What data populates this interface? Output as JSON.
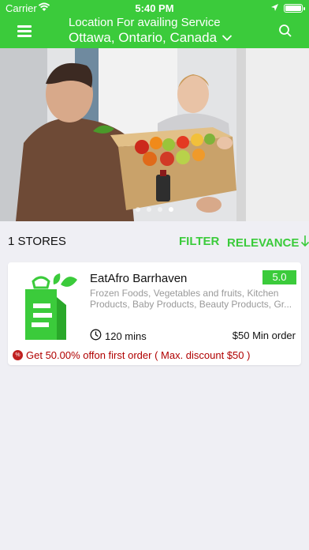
{
  "status_bar": {
    "carrier": "Carrier",
    "time": "5:40 PM"
  },
  "header": {
    "location_label": "Location For availing Service",
    "location_value": "Ottawa, Ontario, Canada"
  },
  "banner": {
    "slide_count": 4,
    "active_index": 3
  },
  "toolbar": {
    "store_count": "1 STORES",
    "filter_label": "FILTER",
    "sort_label": "RELEVANCE"
  },
  "stores": [
    {
      "name": "EatAfro Barrhaven",
      "rating": "5.0",
      "categories": "Frozen Foods, Vegetables and fruits, Kitchen Products, Baby Products, Beauty Products, Gr...",
      "delivery_time": "120 mins",
      "min_order": "$50 Min order",
      "offer": "Get 50.00% offon first order ( Max. discount $50 )",
      "offer_badge": "%"
    }
  ],
  "colors": {
    "accent": "#3bcb3b",
    "offer_red": "#b00000",
    "background": "#efeff4"
  }
}
